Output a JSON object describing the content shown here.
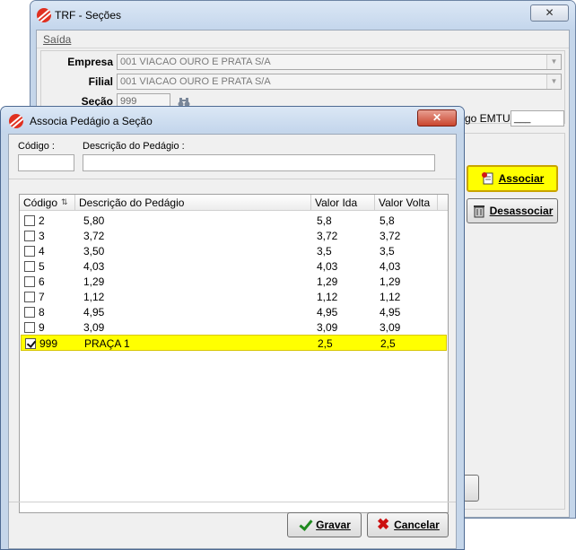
{
  "main_window": {
    "title": "TRF - Seções",
    "close_symbol": "✕",
    "menu": [
      "Saída"
    ],
    "empresa": {
      "label": "Empresa",
      "value": "001 VIACAO OURO E PRATA S/A"
    },
    "filial": {
      "label": "Filial",
      "value": "001 VIACAO OURO E PRATA S/A"
    },
    "secao": {
      "label": "Seção",
      "value": "999"
    },
    "emtu": {
      "label": "go EMTU",
      "value": "___"
    },
    "associar_button": "Associar",
    "desassociar_button": "Desassociar"
  },
  "dialog": {
    "title": "Associa Pedágio a Seção",
    "close_symbol": "✕",
    "filter": {
      "codigo_label": "Código :",
      "codigo_value": "",
      "descricao_label": "Descrição do Pedágio :",
      "descricao_value": ""
    },
    "grid": {
      "columns": [
        "Código",
        "Descrição do Pedágio",
        "Valor Ida",
        "Valor Volta"
      ],
      "rows": [
        {
          "checked": false,
          "codigo": "2",
          "descricao": "5,80",
          "valor_ida": "5,8",
          "valor_volta": "5,8"
        },
        {
          "checked": false,
          "codigo": "3",
          "descricao": "3,72",
          "valor_ida": "3,72",
          "valor_volta": "3,72"
        },
        {
          "checked": false,
          "codigo": "4",
          "descricao": "3,50",
          "valor_ida": "3,5",
          "valor_volta": "3,5"
        },
        {
          "checked": false,
          "codigo": "5",
          "descricao": "4,03",
          "valor_ida": "4,03",
          "valor_volta": "4,03"
        },
        {
          "checked": false,
          "codigo": "6",
          "descricao": "1,29",
          "valor_ida": "1,29",
          "valor_volta": "1,29"
        },
        {
          "checked": false,
          "codigo": "7",
          "descricao": "1,12",
          "valor_ida": "1,12",
          "valor_volta": "1,12"
        },
        {
          "checked": false,
          "codigo": "8",
          "descricao": "4,95",
          "valor_ida": "4,95",
          "valor_volta": "4,95"
        },
        {
          "checked": false,
          "codigo": "9",
          "descricao": "3,09",
          "valor_ida": "3,09",
          "valor_volta": "3,09"
        },
        {
          "checked": true,
          "codigo": "999",
          "descricao": "PRAÇA 1",
          "valor_ida": "2,5",
          "valor_volta": "2,5"
        }
      ]
    },
    "gravar_button": "Gravar",
    "cancelar_button": "Cancelar"
  },
  "colors": {
    "selected_row": "#ffff00",
    "title_bar": "#c5d6ea",
    "associar_bg": "#ffff00"
  }
}
